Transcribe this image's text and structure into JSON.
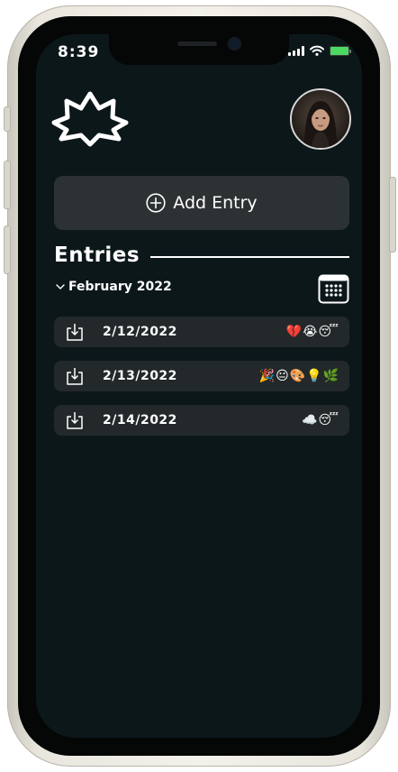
{
  "status_bar": {
    "time": "8:39"
  },
  "header": {
    "logo_icon": "leaf-outline-icon",
    "avatar_icon": "profile-avatar"
  },
  "actions": {
    "add_entry_label": "Add Entry",
    "add_icon": "plus-circle-icon"
  },
  "entries": {
    "title": "Entries",
    "month_label": "February 2022",
    "calendar_icon": "calendar-grid-icon",
    "items": [
      {
        "date": "2/12/2022",
        "moods": [
          "💔",
          "😭",
          "😴"
        ]
      },
      {
        "date": "2/13/2022",
        "moods": [
          "🎉",
          "😐",
          "🎨",
          "💡",
          "🌿"
        ]
      },
      {
        "date": "2/14/2022",
        "moods": [
          "☁️",
          "😴"
        ]
      }
    ]
  },
  "colors": {
    "screen_bg": "#0c171a",
    "card_bg": "#2c3133",
    "row_bg": "#23292b",
    "text": "#ffffff",
    "battery": "#4bd964"
  }
}
